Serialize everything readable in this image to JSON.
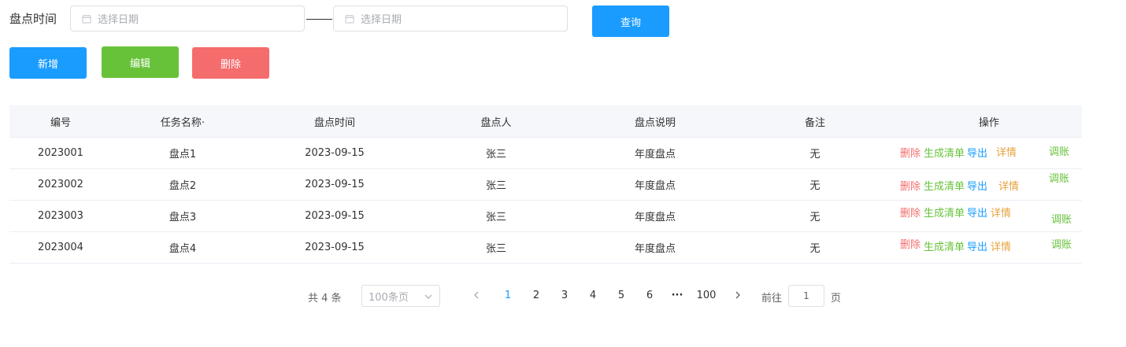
{
  "filter": {
    "label": "盘点时间",
    "start_placeholder": "选择日期",
    "end_placeholder": "选择日期",
    "query_label": "查询"
  },
  "actions": {
    "add_label": "新增",
    "edit_label": "编辑",
    "delete_label": "删除"
  },
  "table": {
    "headers": [
      "编号",
      "任务名称·",
      "盘点时间",
      "盘点人",
      "盘点说明",
      "备注",
      "操作"
    ],
    "rows": [
      {
        "id": "2023001",
        "name": "盘点1",
        "time": "2023-09-15",
        "person": "张三",
        "desc": "年度盘点",
        "note": "无"
      },
      {
        "id": "2023002",
        "name": "盘点2",
        "time": "2023-09-15",
        "person": "张三",
        "desc": "年度盘点",
        "note": "无"
      },
      {
        "id": "2023003",
        "name": "盘点3",
        "time": "2023-09-15",
        "person": "张三",
        "desc": "年度盘点",
        "note": "无"
      },
      {
        "id": "2023004",
        "name": "盘点4",
        "time": "2023-09-15",
        "person": "张三",
        "desc": "年度盘点",
        "note": "无"
      }
    ],
    "row_ops": {
      "delete": "删除",
      "generate": "生成清单",
      "export": "导出",
      "detail": "详情",
      "adjust": "调账"
    }
  },
  "pagination": {
    "total_text": "共 4 条",
    "page_size": "100条页",
    "pages": [
      "1",
      "2",
      "3",
      "4",
      "5",
      "6",
      "···",
      "100"
    ],
    "current": "1",
    "goto_label": "前往",
    "goto_value": "1",
    "page_suffix": "页"
  },
  "colors": {
    "primary": "#1a9cff",
    "success": "#67c23a",
    "danger": "#f56c6c",
    "warning": "#e6a23c"
  }
}
